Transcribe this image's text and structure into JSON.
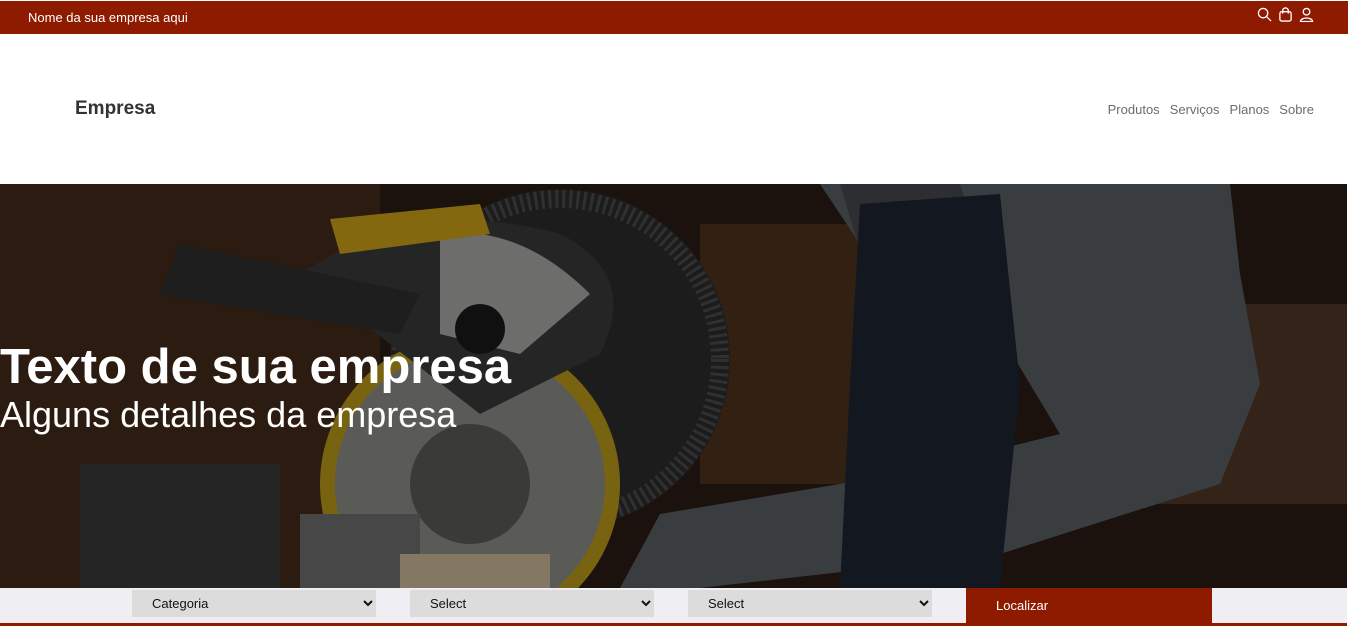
{
  "topbar": {
    "company_name": "Nome da sua empresa aqui",
    "icons": [
      "search-icon",
      "shopping-bag-icon",
      "user-icon"
    ],
    "color": "#8e1a00"
  },
  "header": {
    "brand": "Empresa",
    "nav": [
      {
        "label": "Produtos"
      },
      {
        "label": "Serviços"
      },
      {
        "label": "Planos"
      },
      {
        "label": "Sobre"
      }
    ]
  },
  "hero": {
    "title": "Texto de sua empresa",
    "subtitle": "Alguns detalhes da empresa"
  },
  "search": {
    "category": {
      "selected": "Categoria"
    },
    "select2": {
      "selected": "Select"
    },
    "select3": {
      "selected": "Select"
    },
    "button_label": "Localizar",
    "button_color": "#8e1a00"
  }
}
